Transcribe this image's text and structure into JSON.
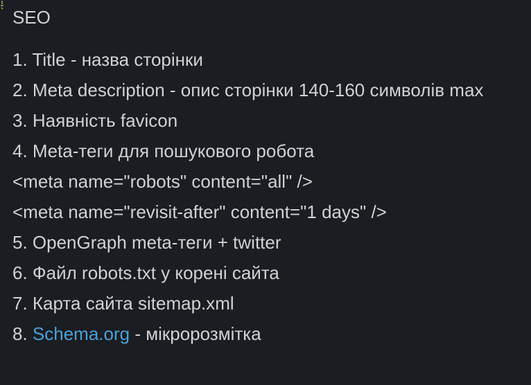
{
  "message": {
    "title": "SEO",
    "lines": [
      "1. Title - назва сторінки",
      "2. Meta description - опис сторінки 140-160 символів max",
      "3. Наявність favicon",
      "4. Meta-теги для пошукового робота",
      "<meta name=\"robots\" content=\"all\" />",
      "<meta name=\"revisit-after\" content=\"1 days\" />",
      "5. OpenGraph meta-теги + twitter",
      "6. Файл robots.txt у корені сайта",
      "7. Карта сайта sitemap.xml"
    ],
    "last_line": {
      "prefix": "8. ",
      "link_text": "Schema.org",
      "suffix": " - мікророзмітка"
    }
  },
  "colors": {
    "background": "#1a1d21",
    "text": "#d1d2d3",
    "link": "#4ba0d8"
  }
}
